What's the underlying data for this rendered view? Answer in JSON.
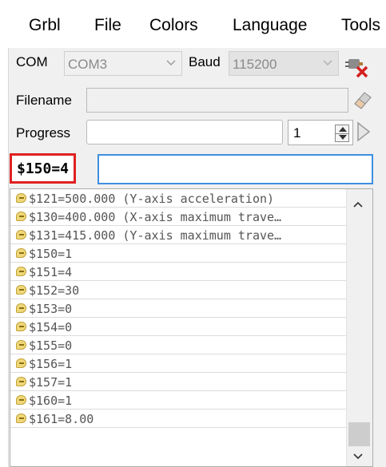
{
  "menu": [
    "Grbl",
    "File",
    "Colors",
    "Language",
    "Tools"
  ],
  "connection": {
    "com_label": "COM",
    "com_value": "COM3",
    "baud_label": "Baud",
    "baud_value": "115200"
  },
  "filename": {
    "label": "Filename",
    "value": ""
  },
  "progress": {
    "label": "Progress",
    "spinner_value": "1"
  },
  "command": {
    "value": "$150=4"
  },
  "console": {
    "lines": [
      "$121=500.000 (Y-axis acceleration)",
      "$130=400.000 (X-axis maximum trave…",
      "$131=415.000 (Y-axis maximum trave…",
      "$150=1",
      "$151=4",
      "$152=30",
      "$153=0",
      "$154=0",
      "$155=0",
      "$156=1",
      "$157=1",
      "$160=1",
      "$161=8.00"
    ]
  },
  "icons": {
    "disconnect": "disconnect-plug-icon",
    "clear": "eraser-icon",
    "run": "play-icon",
    "console_line": "speech-bubble-icon"
  },
  "colors": {
    "command_highlight": "#e02020",
    "input_focus": "#3d8fe0",
    "panel_bg": "#f0f0f0"
  }
}
